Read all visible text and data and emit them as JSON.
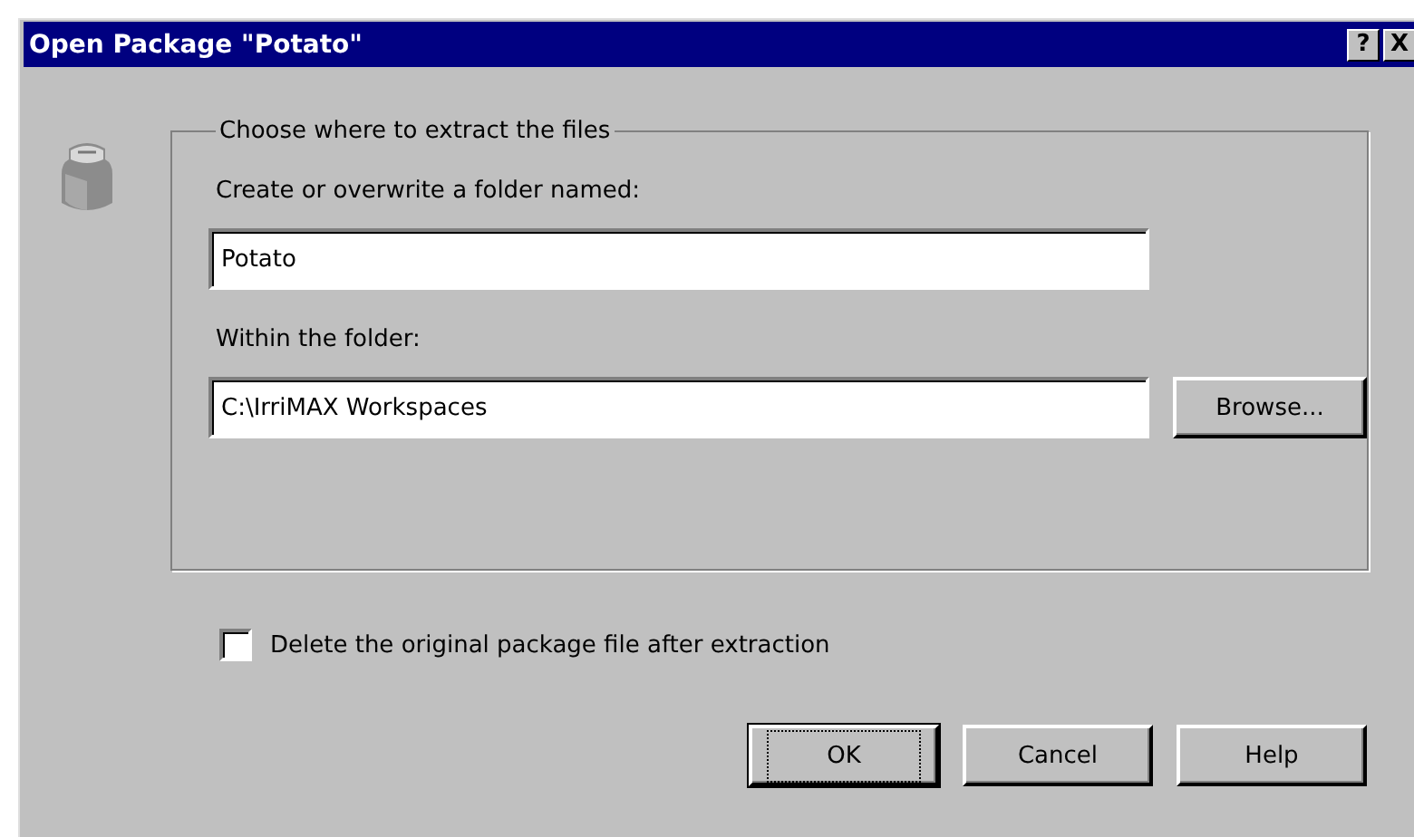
{
  "window": {
    "title": "Open Package \"Potato\"",
    "title_buttons": [
      "?",
      "X"
    ]
  },
  "group": {
    "legend": "Choose where to extract the files",
    "fields": [
      {
        "label": "Create or overwrite a folder named:",
        "value": "Potato"
      },
      {
        "label": "Within the folder:",
        "value": "C:\\IrriMAX Workspaces",
        "button": "Browse..."
      }
    ]
  },
  "checkbox": {
    "label": "Delete the original package file after extraction",
    "checked": false
  },
  "buttons": [
    {
      "label": "OK",
      "default": true
    },
    {
      "label": "Cancel",
      "default": false
    },
    {
      "label": "Help",
      "default": false
    }
  ]
}
